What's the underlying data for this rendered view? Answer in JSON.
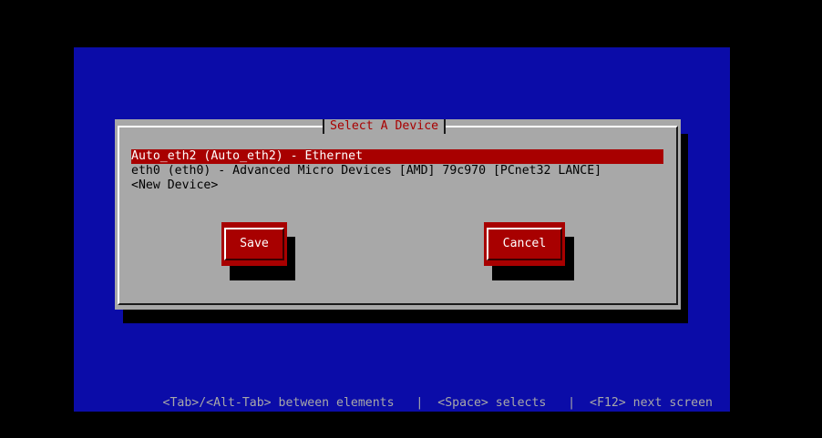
{
  "dialog": {
    "title": "Select A Device",
    "devices": [
      "Auto_eth2 (Auto_eth2) - Ethernet",
      "eth0 (eth0) - Advanced Micro Devices [AMD] 79c970 [PCnet32 LANCE]",
      "<New Device>"
    ],
    "selected_index": 0,
    "buttons": {
      "save": "Save",
      "cancel": "Cancel"
    }
  },
  "status_bar": {
    "tab_hint": "<Tab>/<Alt-Tab> between elements",
    "separator": "|",
    "space_hint": "<Space> selects",
    "f12_hint": "<F12> next screen"
  },
  "colors": {
    "background": "#0b0ca8",
    "dialog": "#a8a8a8",
    "accent": "#a80000"
  }
}
